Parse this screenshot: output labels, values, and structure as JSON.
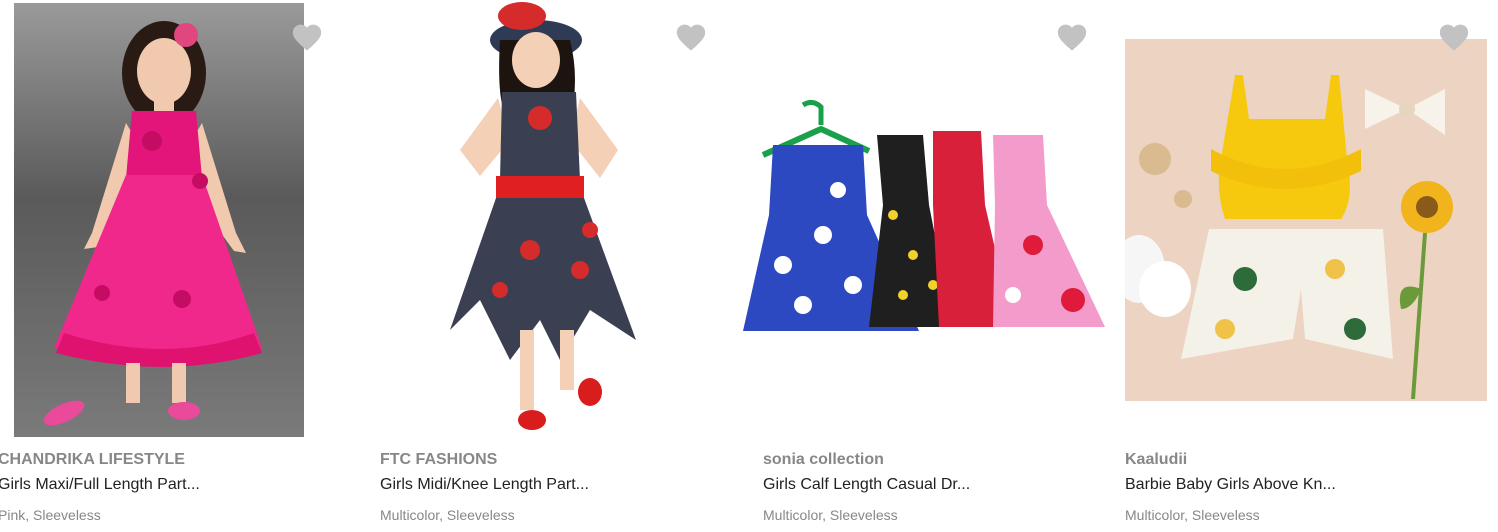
{
  "products": [
    {
      "brand": "CHANDRIKA LIFESTYLE",
      "title": "Girls Maxi/Full Length Part...",
      "meta": "Pink, Sleeveless",
      "wishlist_icon": "heart-icon"
    },
    {
      "brand": "FTC FASHIONS",
      "title": "Girls Midi/Knee Length Part...",
      "meta": "Multicolor, Sleeveless",
      "wishlist_icon": "heart-icon"
    },
    {
      "brand": "sonia collection",
      "title": "Girls Calf Length Casual Dr...",
      "meta": "Multicolor, Sleeveless",
      "wishlist_icon": "heart-icon"
    },
    {
      "brand": "Kaaludii",
      "title": "Barbie Baby Girls Above Kn...",
      "meta": "Multicolor, Sleeveless",
      "wishlist_icon": "heart-icon"
    }
  ],
  "colors": {
    "heart": "#c2c2c2",
    "brand_text": "#878787",
    "title_text": "#212121"
  }
}
